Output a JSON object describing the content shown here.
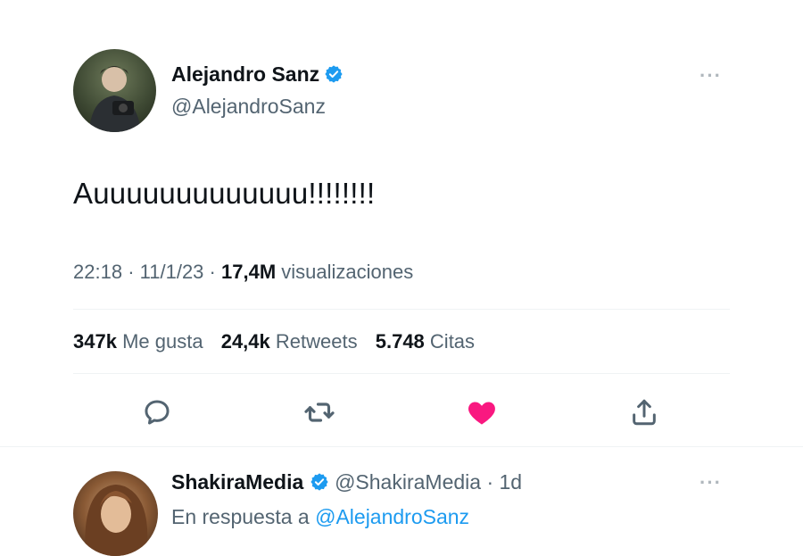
{
  "main_tweet": {
    "author": {
      "display_name": "Alejandro Sanz",
      "handle": "@AlejandroSanz"
    },
    "text": "Auuuuuuuuuuuuu!!!!!!!!",
    "time": "22:18",
    "date": "11/1/23",
    "views_count": "17,4M",
    "views_label": "visualizaciones",
    "stats": {
      "likes_count": "347k",
      "likes_label": "Me gusta",
      "retweets_count": "24,4k",
      "retweets_label": "Retweets",
      "quotes_count": "5.748",
      "quotes_label": "Citas"
    },
    "actions": [
      {
        "icon": "reply-icon"
      },
      {
        "icon": "retweet-icon"
      },
      {
        "icon": "heart-icon",
        "state": "liked"
      },
      {
        "icon": "share-icon"
      }
    ]
  },
  "reply_tweet": {
    "author": {
      "display_name": "ShakiraMedia",
      "handle": "@ShakiraMedia"
    },
    "age": "1d",
    "reply_prefix": "En respuesta a",
    "reply_target": "@AlejandroSanz"
  },
  "colors": {
    "verified": "#1d9bf0",
    "like_active": "#f91880",
    "icon_gray": "#536471",
    "link": "#1d9bf0"
  }
}
